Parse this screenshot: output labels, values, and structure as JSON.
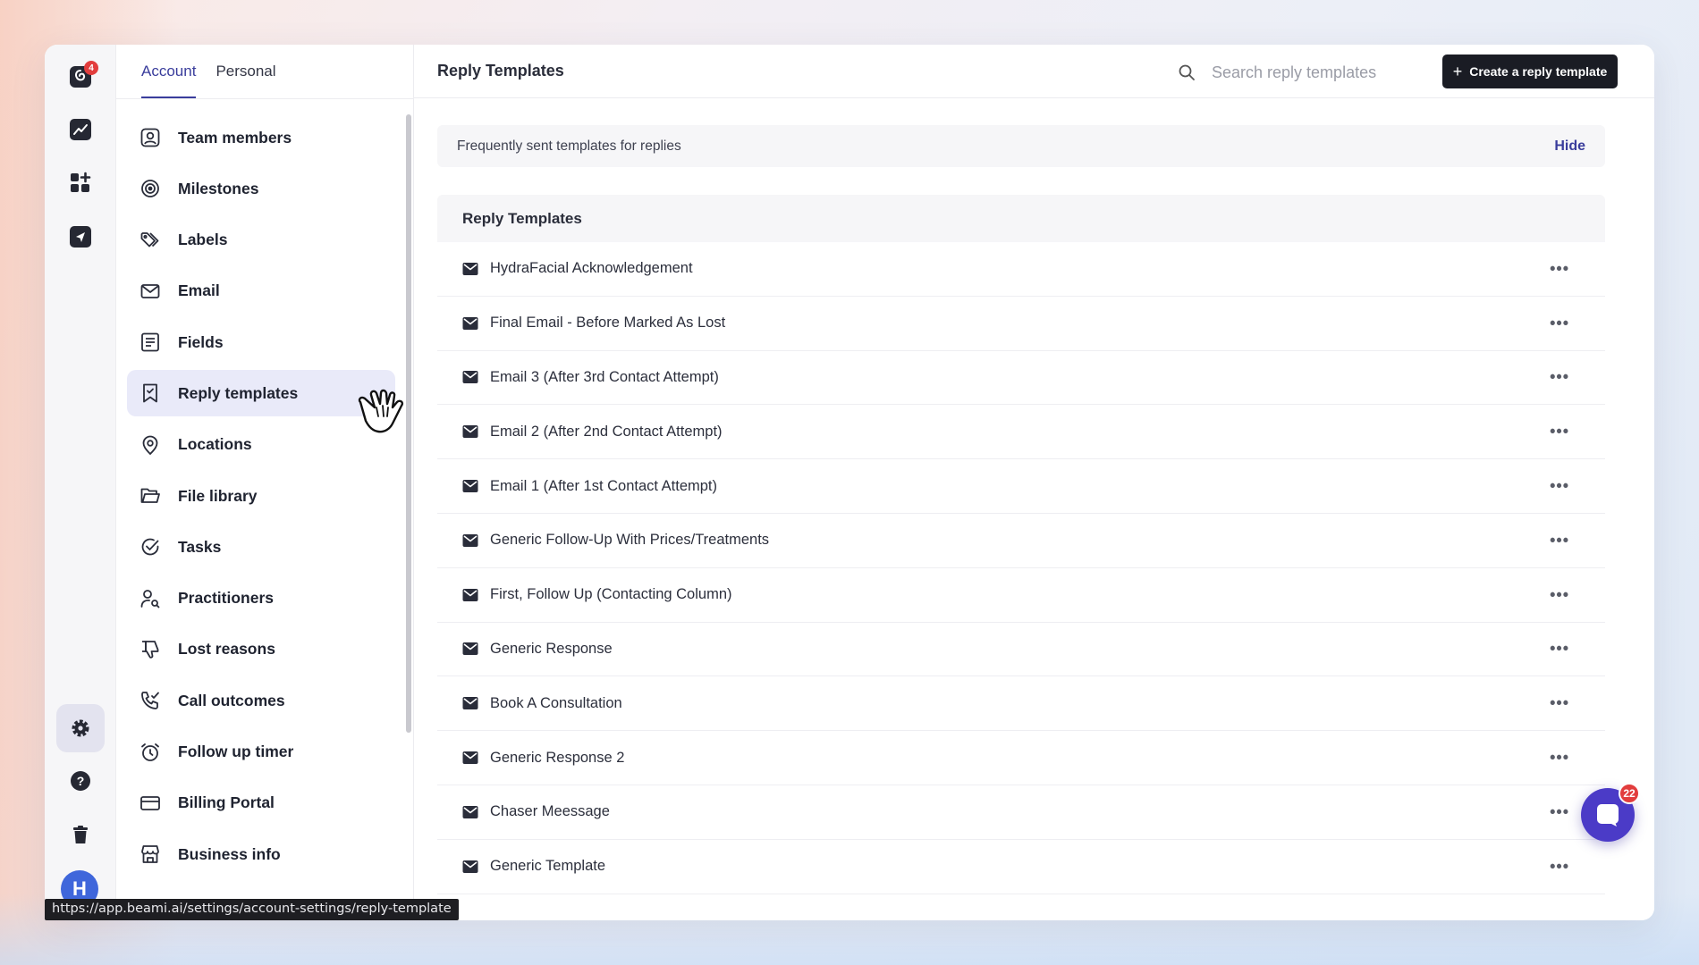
{
  "rail": {
    "logo_badge": "4",
    "avatar_initial": "H"
  },
  "settings": {
    "tabs": [
      {
        "label": "Account",
        "active": true
      },
      {
        "label": "Personal",
        "active": false
      }
    ],
    "nav_items": [
      {
        "label": "Team members",
        "icon": "user-circle-icon"
      },
      {
        "label": "Milestones",
        "icon": "target-icon"
      },
      {
        "label": "Labels",
        "icon": "tags-icon"
      },
      {
        "label": "Email",
        "icon": "envelope-icon"
      },
      {
        "label": "Fields",
        "icon": "list-icon"
      },
      {
        "label": "Reply templates",
        "icon": "bookmark-icon",
        "active": true
      },
      {
        "label": "Locations",
        "icon": "location-pin-icon"
      },
      {
        "label": "File library",
        "icon": "folder-icon"
      },
      {
        "label": "Tasks",
        "icon": "check-circle-icon"
      },
      {
        "label": "Practitioners",
        "icon": "user-search-icon"
      },
      {
        "label": "Lost reasons",
        "icon": "thumbs-down-icon"
      },
      {
        "label": "Call outcomes",
        "icon": "phone-icon"
      },
      {
        "label": "Follow up timer",
        "icon": "alarm-clock-icon"
      },
      {
        "label": "Billing Portal",
        "icon": "credit-card-icon"
      },
      {
        "label": "Business info",
        "icon": "storefront-icon"
      }
    ]
  },
  "main": {
    "title": "Reply Templates",
    "search_placeholder": "Search reply templates",
    "create_button": "Create a reply template",
    "frequent_banner": "Frequently sent templates for replies",
    "hide_link": "Hide",
    "section_title": "Reply Templates",
    "templates": [
      "HydraFacial Acknowledgement",
      "Final Email - Before Marked As Lost",
      "Email 3 (After 3rd Contact Attempt)",
      "Email 2 (After 2nd Contact Attempt)",
      "Email 1 (After 1st Contact Attempt)",
      "Generic Follow-Up With Prices/Treatments",
      "First, Follow Up (Contacting Column)",
      "Generic Response",
      "Book A Consultation",
      "Generic Response 2",
      "Chaser Meessage",
      "Generic Template"
    ],
    "more_label": "•••"
  },
  "chat": {
    "badge": "22"
  },
  "status_url": "https://app.beami.ai/settings/account-settings/reply-template",
  "colors": {
    "accent": "#3a3d9c",
    "active_nav_bg": "#e9eaf9",
    "button_dark": "#1a1c24",
    "chat_widget": "#4b3bc7",
    "badge_red": "#e23d3d",
    "avatar_blue": "#3f66db"
  }
}
